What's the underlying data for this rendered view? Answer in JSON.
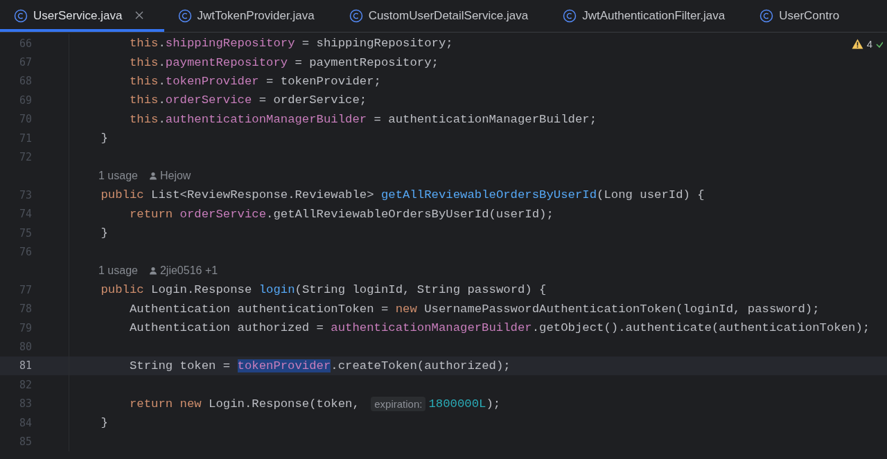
{
  "tabs": [
    {
      "label": "UserService.java",
      "selected": true,
      "closable": true
    },
    {
      "label": "JwtTokenProvider.java",
      "selected": false,
      "closable": false
    },
    {
      "label": "CustomUserDetailService.java",
      "selected": false,
      "closable": false
    },
    {
      "label": "JwtAuthenticationFilter.java",
      "selected": false,
      "closable": false
    },
    {
      "label": "UserContro",
      "selected": false,
      "closable": false
    }
  ],
  "inspections": {
    "warnings": "4"
  },
  "lines": [
    {
      "kind": "code",
      "number": "66",
      "current": false,
      "tokens": [
        {
          "text": "        this",
          "kind": "keyword"
        },
        {
          "text": ".",
          "kind": "plain"
        },
        {
          "text": "shippingRepository",
          "kind": "field"
        },
        {
          "text": " = shippingRepository;",
          "kind": "plain"
        }
      ]
    },
    {
      "kind": "code",
      "number": "67",
      "current": false,
      "tokens": [
        {
          "text": "        this",
          "kind": "keyword"
        },
        {
          "text": ".",
          "kind": "plain"
        },
        {
          "text": "paymentRepository",
          "kind": "field"
        },
        {
          "text": " = paymentRepository;",
          "kind": "plain"
        }
      ]
    },
    {
      "kind": "code",
      "number": "68",
      "current": false,
      "tokens": [
        {
          "text": "        this",
          "kind": "keyword"
        },
        {
          "text": ".",
          "kind": "plain"
        },
        {
          "text": "tokenProvider",
          "kind": "field"
        },
        {
          "text": " = tokenProvider;",
          "kind": "plain"
        }
      ]
    },
    {
      "kind": "code",
      "number": "69",
      "current": false,
      "tokens": [
        {
          "text": "        this",
          "kind": "keyword"
        },
        {
          "text": ".",
          "kind": "plain"
        },
        {
          "text": "orderService",
          "kind": "field"
        },
        {
          "text": " = orderService;",
          "kind": "plain"
        }
      ]
    },
    {
      "kind": "code",
      "number": "70",
      "current": false,
      "tokens": [
        {
          "text": "        this",
          "kind": "keyword"
        },
        {
          "text": ".",
          "kind": "plain"
        },
        {
          "text": "authenticationManagerBuilder",
          "kind": "field"
        },
        {
          "text": " = authenticationManagerBuilder;",
          "kind": "plain"
        }
      ]
    },
    {
      "kind": "code",
      "number": "71",
      "current": false,
      "tokens": [
        {
          "text": "    }",
          "kind": "plain"
        }
      ]
    },
    {
      "kind": "code",
      "number": "72",
      "current": false
    },
    {
      "kind": "annotation",
      "usage": "1 usage",
      "author": "Hejow"
    },
    {
      "kind": "code",
      "number": "73",
      "current": false,
      "tokens": [
        {
          "text": "    public",
          "kind": "keyword"
        },
        {
          "text": " List<ReviewResponse.Reviewable> ",
          "kind": "plain"
        },
        {
          "text": "getAllReviewableOrdersByUserId",
          "kind": "declaration"
        },
        {
          "text": "(Long userId) {",
          "kind": "plain"
        }
      ]
    },
    {
      "kind": "code",
      "number": "74",
      "current": false,
      "tokens": [
        {
          "text": "        return ",
          "kind": "keyword"
        },
        {
          "text": "orderService",
          "kind": "field"
        },
        {
          "text": ".getAllReviewableOrdersByUserId(userId);",
          "kind": "plain"
        }
      ]
    },
    {
      "kind": "code",
      "number": "75",
      "current": false,
      "tokens": [
        {
          "text": "    }",
          "kind": "plain"
        }
      ]
    },
    {
      "kind": "code",
      "number": "76",
      "current": false
    },
    {
      "kind": "annotation",
      "usage": "1 usage",
      "author": "2jie0516 +1"
    },
    {
      "kind": "code",
      "number": "77",
      "current": false,
      "tokens": [
        {
          "text": "    public",
          "kind": "keyword"
        },
        {
          "text": " Login.Response ",
          "kind": "plain"
        },
        {
          "text": "login",
          "kind": "declaration"
        },
        {
          "text": "(String loginId, String password) {",
          "kind": "plain"
        }
      ]
    },
    {
      "kind": "code",
      "number": "78",
      "current": false,
      "tokens": [
        {
          "text": "        Authentication authenticationToken = ",
          "kind": "plain"
        },
        {
          "text": "new",
          "kind": "keyword"
        },
        {
          "text": " UsernamePasswordAuthenticationToken(loginId, password);",
          "kind": "plain"
        }
      ]
    },
    {
      "kind": "code",
      "number": "79",
      "current": false,
      "tokens": [
        {
          "text": "        Authentication authorized = ",
          "kind": "plain"
        },
        {
          "text": "authenticationManagerBuilder",
          "kind": "field"
        },
        {
          "text": ".getObject().authenticate(authenticationToken);",
          "kind": "plain"
        }
      ]
    },
    {
      "kind": "code",
      "number": "80",
      "current": false
    },
    {
      "kind": "code",
      "number": "81",
      "current": true,
      "tokens": [
        {
          "text": "        String token = ",
          "kind": "plain"
        },
        {
          "text": "tokenProvider",
          "kind": "selected-field"
        },
        {
          "text": ".createToken(authorized);",
          "kind": "plain"
        }
      ]
    },
    {
      "kind": "code",
      "number": "82",
      "current": false
    },
    {
      "kind": "code",
      "number": "83",
      "current": false,
      "tokens": [
        {
          "text": "        return new",
          "kind": "keyword"
        },
        {
          "text": " Login.Response(token, ",
          "kind": "plain"
        },
        {
          "text": "expiration:",
          "kind": "hint"
        },
        {
          "text": "1800000L",
          "kind": "number"
        },
        {
          "text": ");",
          "kind": "plain"
        }
      ]
    },
    {
      "kind": "code",
      "number": "84",
      "current": false,
      "tokens": [
        {
          "text": "    }",
          "kind": "plain"
        }
      ]
    },
    {
      "kind": "code",
      "number": "85",
      "current": false
    }
  ]
}
